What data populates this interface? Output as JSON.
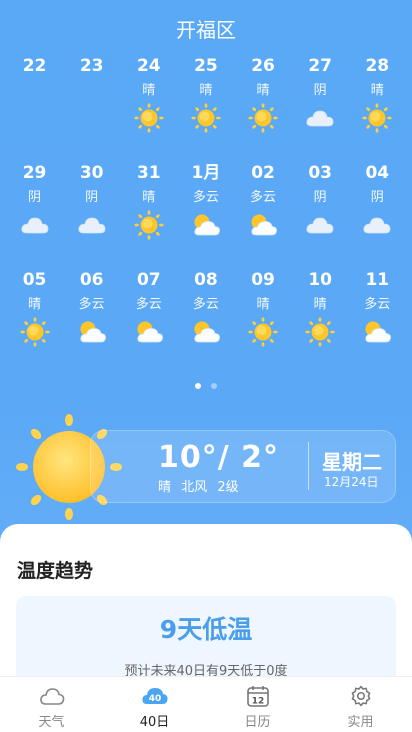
{
  "header": {
    "title": "开福区"
  },
  "calendar": {
    "rows": [
      [
        {
          "date": "22",
          "cond": "",
          "icon": ""
        },
        {
          "date": "23",
          "cond": "",
          "icon": ""
        },
        {
          "date": "24",
          "cond": "晴",
          "icon": "sun-icon"
        },
        {
          "date": "25",
          "cond": "晴",
          "icon": "sun-icon"
        },
        {
          "date": "26",
          "cond": "晴",
          "icon": "sun-icon"
        },
        {
          "date": "27",
          "cond": "阴",
          "icon": "cloud-icon"
        },
        {
          "date": "28",
          "cond": "晴",
          "icon": "sun-icon"
        }
      ],
      [
        {
          "date": "29",
          "cond": "阴",
          "icon": "cloud-icon"
        },
        {
          "date": "30",
          "cond": "阴",
          "icon": "cloud-icon"
        },
        {
          "date": "31",
          "cond": "晴",
          "icon": "sun-icon"
        },
        {
          "date": "1月",
          "cond": "多云",
          "icon": "partly-cloudy-icon"
        },
        {
          "date": "02",
          "cond": "多云",
          "icon": "partly-cloudy-icon"
        },
        {
          "date": "03",
          "cond": "阴",
          "icon": "cloud-icon"
        },
        {
          "date": "04",
          "cond": "阴",
          "icon": "cloud-icon"
        }
      ],
      [
        {
          "date": "05",
          "cond": "晴",
          "icon": "sun-icon"
        },
        {
          "date": "06",
          "cond": "多云",
          "icon": "partly-cloudy-icon"
        },
        {
          "date": "07",
          "cond": "多云",
          "icon": "partly-cloudy-icon"
        },
        {
          "date": "08",
          "cond": "多云",
          "icon": "partly-cloudy-icon"
        },
        {
          "date": "09",
          "cond": "晴",
          "icon": "sun-icon"
        },
        {
          "date": "10",
          "cond": "晴",
          "icon": "sun-icon"
        },
        {
          "date": "11",
          "cond": "多云",
          "icon": "partly-cloudy-icon"
        }
      ]
    ]
  },
  "pager": {
    "count": 2,
    "active": 0
  },
  "today": {
    "temps": "10°/ 2°",
    "condition": "晴",
    "wind_dir": "北风",
    "wind_level": "2级",
    "weekday": "星期二",
    "date": "12月24日"
  },
  "trend": {
    "title": "温度趋势",
    "headline": "9天低温",
    "subtext": "预计未来40日有9天低于0度"
  },
  "tabs": [
    {
      "label": "天气",
      "icon": "cloud-outline-icon",
      "active": false
    },
    {
      "label": "40日",
      "icon": "forty-day-badge-icon",
      "badge": "40",
      "active": true
    },
    {
      "label": "日历",
      "icon": "calendar-icon",
      "badge": "12",
      "active": false
    },
    {
      "label": "实用",
      "icon": "gear-icon",
      "active": false
    }
  ],
  "colors": {
    "background": "#5aa9f7",
    "accent": "#4a9eea",
    "sun": "#ffcf3a",
    "tab_active": "#4aa6f0"
  }
}
